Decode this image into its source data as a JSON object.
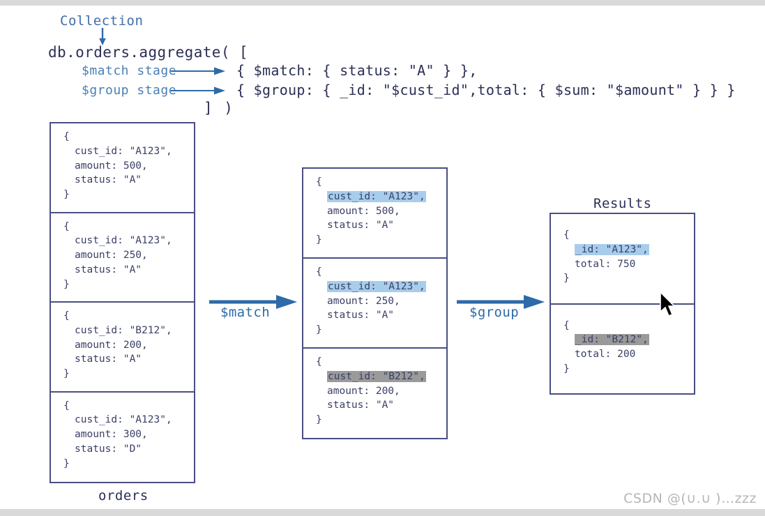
{
  "diagram": {
    "collection_label": "Collection",
    "code": {
      "line1": "db.orders.aggregate( [",
      "match_stage_label": "$match stage",
      "group_stage_label": "$group stage",
      "match_stage_code": "{ $match: { status: \"A\" } },",
      "group_stage_code": "{ $group: { _id: \"$cust_id\",total: { $sum: \"$amount\" } } }",
      "close": "] )"
    },
    "orders_box": {
      "caption": "orders",
      "documents": [
        {
          "open": "{",
          "cust_id": "cust_id: \"A123\",",
          "amount": "amount: 500,",
          "status": "status: \"A\"",
          "close": "}"
        },
        {
          "open": "{",
          "cust_id": "cust_id: \"A123\",",
          "amount": "amount: 250,",
          "status": "status: \"A\"",
          "close": "}"
        },
        {
          "open": "{",
          "cust_id": "cust_id: \"B212\",",
          "amount": "amount: 200,",
          "status": "status: \"A\"",
          "close": "}"
        },
        {
          "open": "{",
          "cust_id": "cust_id: \"A123\",",
          "amount": "amount: 300,",
          "status": "status: \"D\"",
          "close": "}"
        }
      ]
    },
    "match_box": {
      "documents": [
        {
          "open": "{",
          "cust_id": "cust_id: \"A123\",",
          "highlight": "blue",
          "amount": "amount: 500,",
          "status": "status: \"A\"",
          "close": "}"
        },
        {
          "open": "{",
          "cust_id": "cust_id: \"A123\",",
          "highlight": "blue",
          "amount": "amount: 250,",
          "status": "status: \"A\"",
          "close": "}"
        },
        {
          "open": "{",
          "cust_id": "cust_id: \"B212\",",
          "highlight": "gray",
          "amount": "amount: 200,",
          "status": "status: \"A\"",
          "close": "}"
        }
      ]
    },
    "results_box": {
      "caption": "Results",
      "documents": [
        {
          "open": "{",
          "id": "_id: \"A123\",",
          "highlight": "blue",
          "total": "total: 750",
          "close": "}"
        },
        {
          "open": "{",
          "id": "_id: \"B212\",",
          "highlight": "gray",
          "total": "total: 200",
          "close": "}"
        }
      ]
    },
    "arrows": {
      "match_label": "$match",
      "group_label": "$group"
    },
    "watermark": "CSDN @(∪.∪ )…zzz",
    "colors": {
      "box_border": "#4a4e82",
      "code_text": "#2b2f55",
      "stage_label": "#4a7fb5",
      "arrow_blue": "#2e6aa8",
      "highlight_blue": "#a8cdec",
      "highlight_gray": "#9a9a9a"
    }
  }
}
